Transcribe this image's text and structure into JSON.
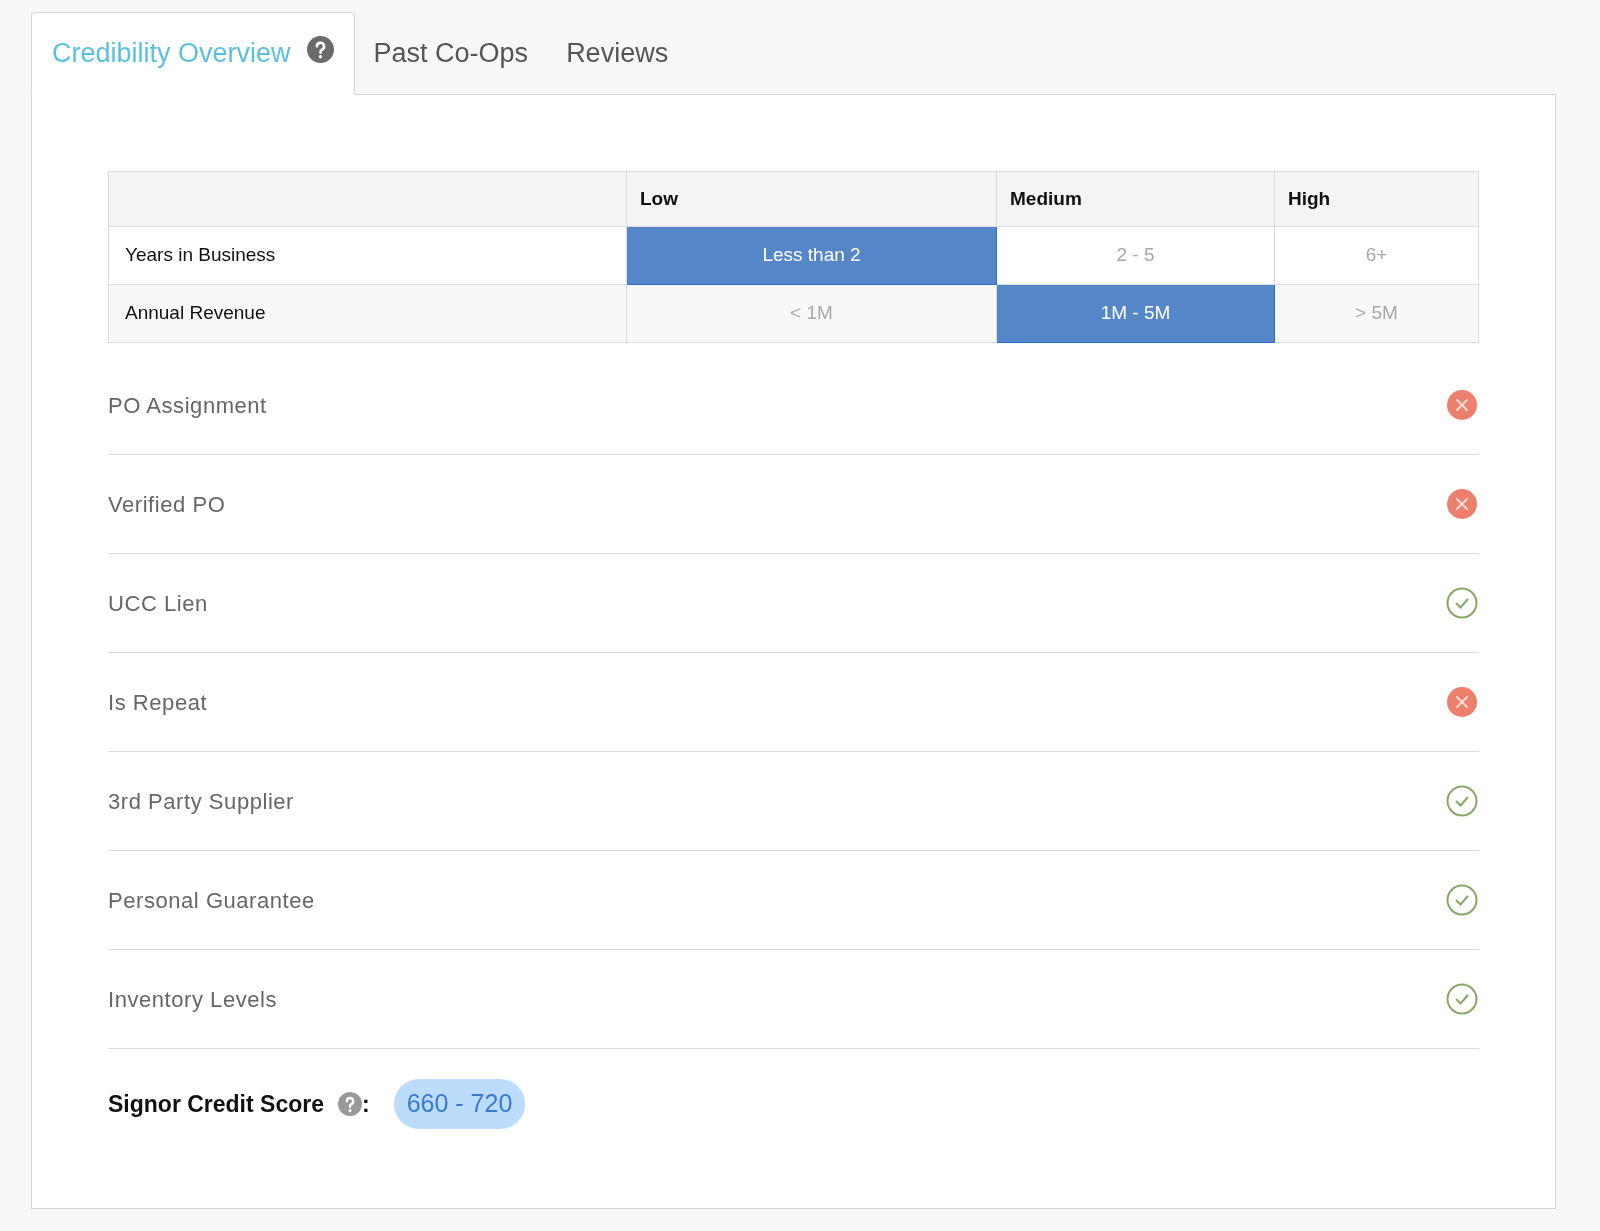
{
  "tabs": [
    {
      "label": "Credibility Overview",
      "selected": true,
      "help": true
    },
    {
      "label": "Past Co-Ops",
      "selected": false,
      "help": false
    },
    {
      "label": "Reviews",
      "selected": false,
      "help": false
    }
  ],
  "table": {
    "columns": [
      "Low",
      "Medium",
      "High"
    ],
    "rows": [
      {
        "label": "Years in Business",
        "cells": [
          {
            "text": "Less than 2",
            "selected": true
          },
          {
            "text": "2 - 5",
            "selected": false
          },
          {
            "text": "6+",
            "selected": false
          }
        ]
      },
      {
        "label": "Annual Revenue",
        "cells": [
          {
            "text": "< 1M",
            "selected": false
          },
          {
            "text": "1M - 5M",
            "selected": true
          },
          {
            "text": "> 5M",
            "selected": false
          }
        ]
      }
    ]
  },
  "checklist": [
    {
      "label": "PO Assignment",
      "passed": false
    },
    {
      "label": "Verified PO",
      "passed": false
    },
    {
      "label": "UCC Lien",
      "passed": true
    },
    {
      "label": "Is Repeat",
      "passed": false
    },
    {
      "label": "3rd Party Supplier",
      "passed": true
    },
    {
      "label": "Personal Guarantee",
      "passed": true
    },
    {
      "label": "Inventory Levels",
      "passed": true
    }
  ],
  "score": {
    "label": "Signor Credit Score",
    "separator": ":",
    "value": "660 - 720"
  }
}
